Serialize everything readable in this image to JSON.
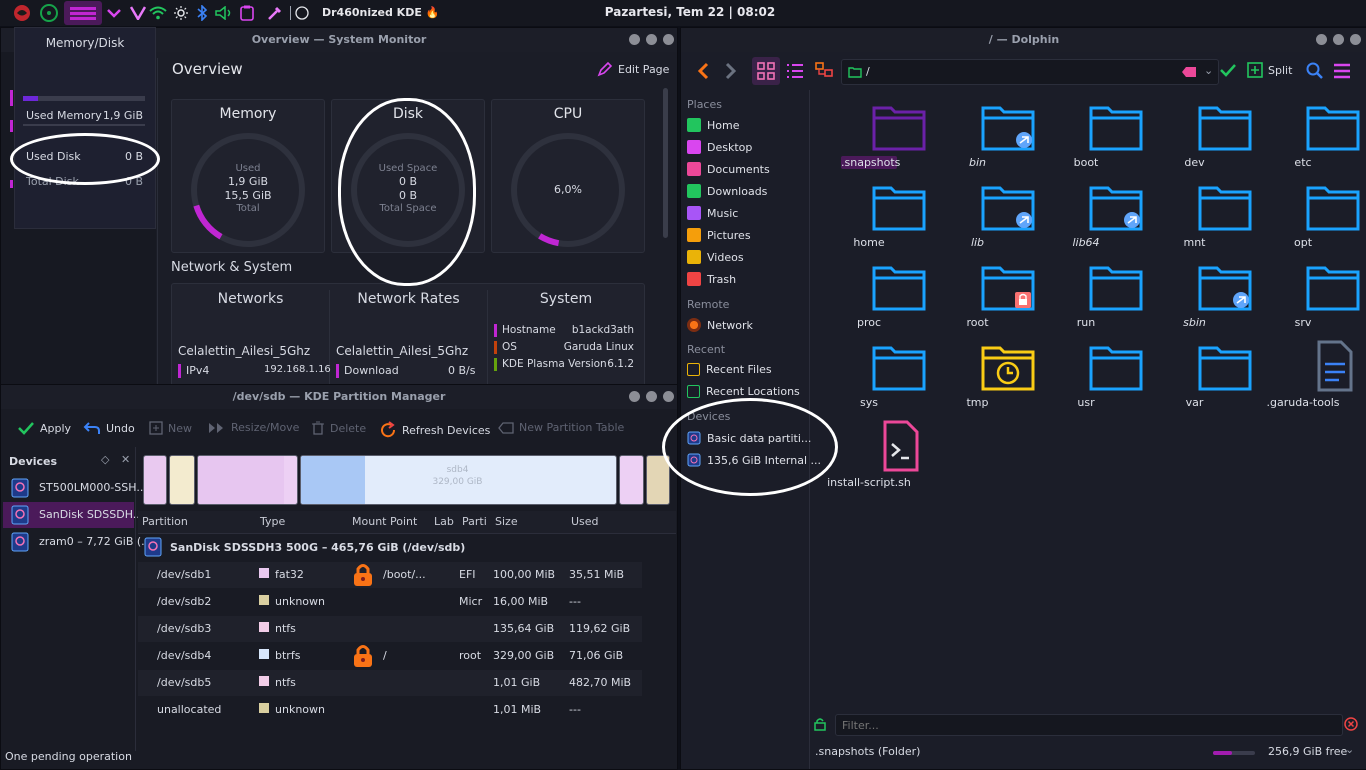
{
  "topbar": {
    "distro_label": "Dr460nized KDE 🔥",
    "clock": "Pazartesi, Tem 22 | 08:02"
  },
  "sysmon": {
    "title": "Overview — System Monitor",
    "page_title": "Overview",
    "edit_page": "Edit Page",
    "memory": {
      "title": "Memory",
      "used_label": "Used",
      "used": "1,9 GiB",
      "total": "15,5 GiB",
      "total_label": "Total",
      "fraction": 0.12
    },
    "disk": {
      "title": "Disk",
      "used_label": "Used Space",
      "used": "0 B",
      "total": "0 B",
      "total_label": "Total Space"
    },
    "cpu": {
      "title": "CPU",
      "value": "6,0%",
      "fraction": 0.06
    },
    "section2": "Network & System",
    "networks": {
      "title": "Networks",
      "ssid": "Celalettin_Ailesi_5Ghz",
      "ipv4_label": "IPv4",
      "ipv4": "192.168.1.16"
    },
    "rates": {
      "title": "Network Rates",
      "ssid": "Celalettin_Ailesi_5Ghz",
      "download_label": "Download",
      "download": "0 B/s"
    },
    "system": {
      "title": "System",
      "rows": [
        {
          "k": "Hostname",
          "v": "b1ackd3ath",
          "c": "#c026d3"
        },
        {
          "k": "OS",
          "v": "Garuda Linux",
          "c": "#c2410c"
        },
        {
          "k": "KDE Plasma Version",
          "v": "6.1.2",
          "c": "#65a30d"
        }
      ]
    }
  },
  "mempopup": {
    "title": "Memory/Disk",
    "used_memory_label": "Used Memory",
    "used_memory": "1,9 GiB",
    "used_disk_label": "Used Disk",
    "used_disk": "0 B",
    "total_disk_label": "Total Disk",
    "total_disk": "0 B",
    "memory_fraction": 0.12
  },
  "pm": {
    "title": "/dev/sdb — KDE Partition Manager",
    "toolbar": {
      "apply": "Apply",
      "undo": "Undo",
      "new": "New",
      "resize": "Resize/Move",
      "delete": "Delete",
      "refresh": "Refresh Devices",
      "new_table": "New Partition Table"
    },
    "devices_label": "Devices",
    "devices": [
      "ST500LM000-SSH...",
      "SanDisk SDSSDH...",
      "zram0 – 7,72 GiB (..."
    ],
    "bar_label_1": "sdb4",
    "bar_label_2": "329,00 GiB",
    "columns": {
      "partition": "Partition",
      "type": "Type",
      "mount": "Mount Point",
      "label": "Lab",
      "parti": "Parti",
      "size": "Size",
      "used": "Used"
    },
    "disk_header": "SanDisk SDSSDH3 500G – 465,76 GiB (/dev/sdb)",
    "rows": [
      {
        "name": "/dev/sdb1",
        "type": "fat32",
        "color": "#e9c9f0",
        "mount": "/boot/...",
        "locked": true,
        "flags": "EFI",
        "size": "100,00 MiB",
        "used": "35,51 MiB"
      },
      {
        "name": "/dev/sdb2",
        "type": "unknown",
        "color": "#d9cfa0",
        "mount": "",
        "locked": false,
        "flags": "Micr",
        "size": "16,00 MiB",
        "used": "---"
      },
      {
        "name": "/dev/sdb3",
        "type": "ntfs",
        "color": "#f2cde8",
        "mount": "",
        "locked": false,
        "flags": "",
        "size": "135,64 GiB",
        "used": "119,62 GiB"
      },
      {
        "name": "/dev/sdb4",
        "type": "btrfs",
        "color": "#d7e6fb",
        "mount": "/",
        "locked": true,
        "flags": "root",
        "size": "329,00 GiB",
        "used": "71,06 GiB"
      },
      {
        "name": "/dev/sdb5",
        "type": "ntfs",
        "color": "#f2cde8",
        "mount": "",
        "locked": false,
        "flags": "",
        "size": "1,01 GiB",
        "used": "482,70 MiB"
      },
      {
        "name": "unallocated",
        "type": "unknown",
        "color": "#d9cfa0",
        "mount": "",
        "locked": false,
        "flags": "",
        "size": "1,01 MiB",
        "used": "---"
      }
    ],
    "status": "One pending operation"
  },
  "dolphin": {
    "title": "/ — Dolphin",
    "path": "/",
    "split": "Split",
    "places_label": "Places",
    "places": [
      {
        "label": "Home",
        "color": "#22c55e"
      },
      {
        "label": "Desktop",
        "color": "#d946ef"
      },
      {
        "label": "Documents",
        "color": "#ec4899"
      },
      {
        "label": "Downloads",
        "color": "#22c55e"
      },
      {
        "label": "Music",
        "color": "#a855f7"
      },
      {
        "label": "Pictures",
        "color": "#f59e0b"
      },
      {
        "label": "Videos",
        "color": "#eab308"
      },
      {
        "label": "Trash",
        "color": "#ef4444"
      }
    ],
    "remote_label": "Remote",
    "network": "Network",
    "recent_label": "Recent",
    "recent_files": "Recent Files",
    "recent_locations": "Recent Locations",
    "devices_label": "Devices",
    "devices": [
      "Basic data partiti...",
      "135,6 GiB Internal ..."
    ],
    "files": [
      {
        "name": ".snapshots",
        "kind": "folder-purple",
        "selected": true
      },
      {
        "name": "bin",
        "kind": "link"
      },
      {
        "name": "boot",
        "kind": "folder"
      },
      {
        "name": "dev",
        "kind": "folder"
      },
      {
        "name": "etc",
        "kind": "folder"
      },
      {
        "name": "home",
        "kind": "folder"
      },
      {
        "name": "lib",
        "kind": "link"
      },
      {
        "name": "lib64",
        "kind": "link"
      },
      {
        "name": "mnt",
        "kind": "folder"
      },
      {
        "name": "opt",
        "kind": "folder"
      },
      {
        "name": "proc",
        "kind": "folder"
      },
      {
        "name": "root",
        "kind": "locked"
      },
      {
        "name": "run",
        "kind": "folder"
      },
      {
        "name": "sbin",
        "kind": "link"
      },
      {
        "name": "srv",
        "kind": "folder"
      },
      {
        "name": "sys",
        "kind": "folder"
      },
      {
        "name": "tmp",
        "kind": "tmp"
      },
      {
        "name": "usr",
        "kind": "folder"
      },
      {
        "name": "var",
        "kind": "folder"
      },
      {
        "name": ".garuda-tools",
        "kind": "doc"
      },
      {
        "name": "install-script.sh",
        "kind": "script"
      }
    ],
    "filter_placeholder": "Filter...",
    "status_left": ".snapshots (Folder)",
    "free_space": "256,9 GiB free",
    "free_fraction": 0.45
  },
  "colors": {
    "accent": "#c026d3",
    "folder_blue": "#1aa3ff",
    "active_row": "#4b1a5a"
  }
}
